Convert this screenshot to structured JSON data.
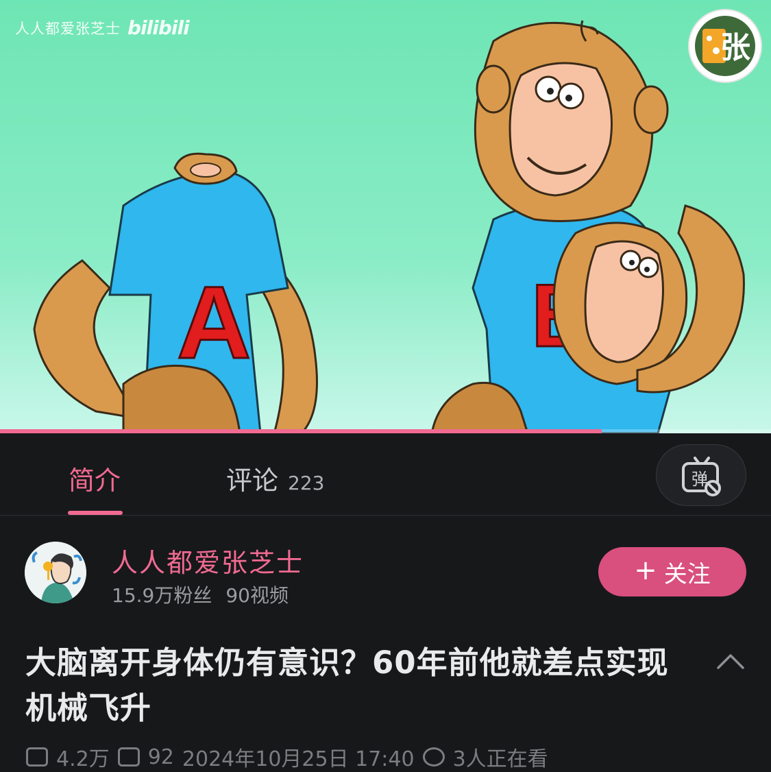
{
  "video": {
    "watermark_text": "人人都爱张芝士",
    "watermark_logo": "bilibili",
    "channel_badge_glyph": "张",
    "progress": 0.78,
    "shirt_letters": [
      "A",
      "B"
    ]
  },
  "tabs": {
    "intro_label": "简介",
    "comments_label": "评论",
    "comments_count": "223",
    "danmaku_icon": "danmaku-off-icon",
    "danmaku_glyph": "弹"
  },
  "uploader": {
    "name": "人人都爱张芝士",
    "followers": "15.9万粉丝",
    "videos": "90视频",
    "follow_label": "关注",
    "follow_icon": "+"
  },
  "video_title": "大脑离开身体仍有意识？60年前他就差点实现机械飞升",
  "meta": {
    "views": "4.2万",
    "danmaku": "92",
    "date": "2024年10月25日 17:40",
    "watching": "3人正在看"
  },
  "colors": {
    "accent": "#f06a92",
    "follow_button": "#d94f7d",
    "background": "#17181a"
  }
}
